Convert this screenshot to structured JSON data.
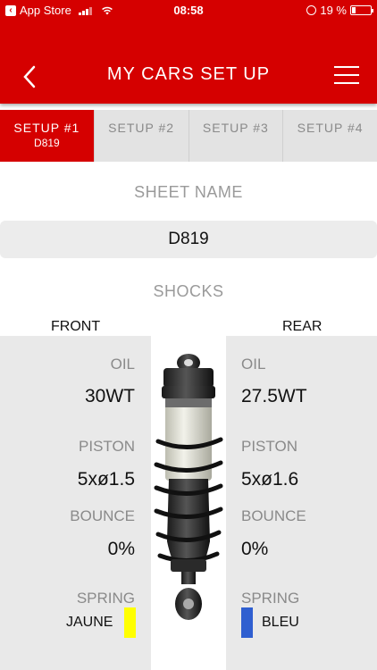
{
  "status": {
    "back_app": "App Store",
    "time": "08:58",
    "battery": "19 %",
    "battery_level": 0.19
  },
  "header": {
    "title": "MY CARS SET UP"
  },
  "tabs": [
    {
      "label": "SETUP #1",
      "sub": "D819",
      "active": true
    },
    {
      "label": "SETUP #2",
      "sub": "",
      "active": false
    },
    {
      "label": "SETUP #3",
      "sub": "",
      "active": false
    },
    {
      "label": "SETUP #4",
      "sub": "",
      "active": false
    }
  ],
  "sheet": {
    "title": "SHEET NAME",
    "value": "D819"
  },
  "shocks": {
    "title": "SHOCKS",
    "front": {
      "label": "FRONT",
      "oil_label": "OIL",
      "oil": "30WT",
      "piston_label": "PISTON",
      "piston": "5xø1.5",
      "bounce_label": "BOUNCE",
      "bounce": "0%",
      "spring_label": "SPRING",
      "spring": "JAUNE",
      "spring_color": "#ffff00"
    },
    "rear": {
      "label": "REAR",
      "oil_label": "OIL",
      "oil": "27.5WT",
      "piston_label": "PISTON",
      "piston": "5xø1.6",
      "bounce_label": "BOUNCE",
      "bounce": "0%",
      "spring_label": "SPRING",
      "spring": "BLEU",
      "spring_color": "#2f5fd0"
    }
  },
  "colors": {
    "accent": "#d50000",
    "panel": "#e9e9e9"
  }
}
